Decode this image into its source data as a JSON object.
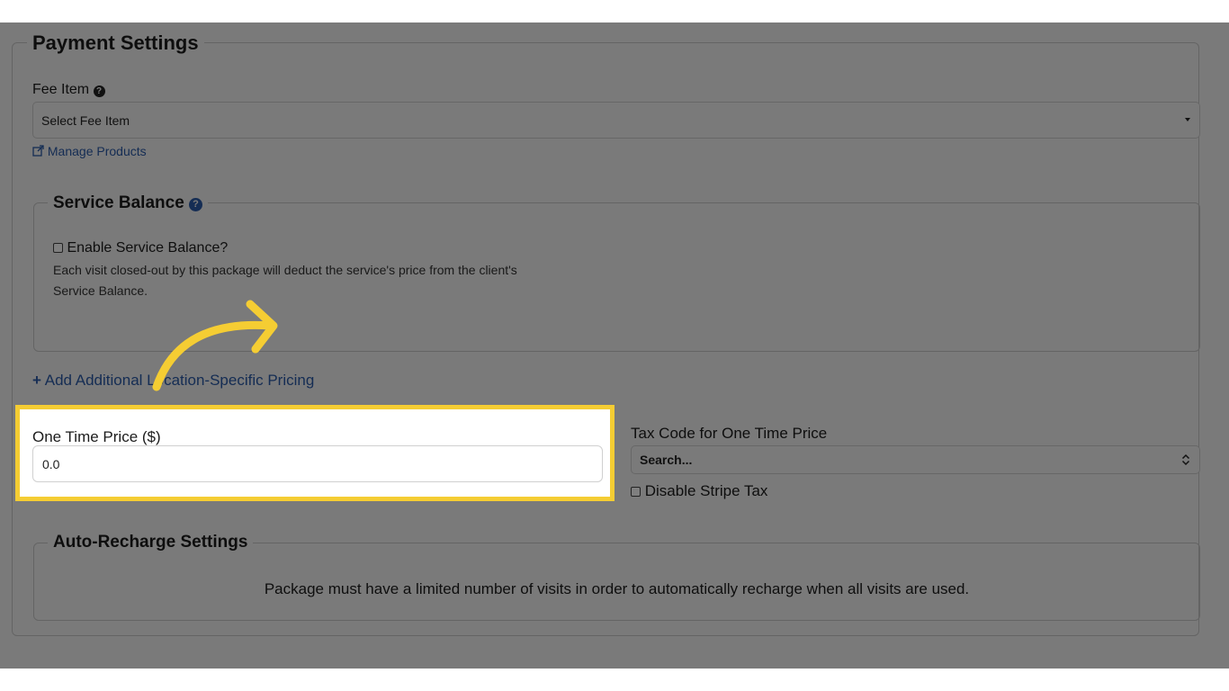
{
  "payment_settings": {
    "title": "Payment Settings",
    "fee_item_label": "Fee Item",
    "fee_item_value": "Select Fee Item",
    "manage_products_link": "Manage Products"
  },
  "service_balance": {
    "title": "Service Balance",
    "checkbox_label": "Enable Service Balance?",
    "help_line1": "Each visit closed-out by this package will deduct the service's price from the client's",
    "help_line2": "Service Balance."
  },
  "add_pricing_link": "Add Additional Location-Specific Pricing",
  "one_time_price": {
    "label": "One Time Price ($)",
    "value": "0.0"
  },
  "tax_code": {
    "label": "Tax Code for One Time Price",
    "value": "Search...",
    "disable_stripe_label": "Disable Stripe Tax"
  },
  "auto_recharge": {
    "title": "Auto-Recharge Settings",
    "message": "Package must have a limited number of visits in order to automatically recharge when all visits are used."
  },
  "colors": {
    "highlight": "#f5cd33",
    "arrow": "#f5cd33",
    "link": "#2b5aa8"
  }
}
